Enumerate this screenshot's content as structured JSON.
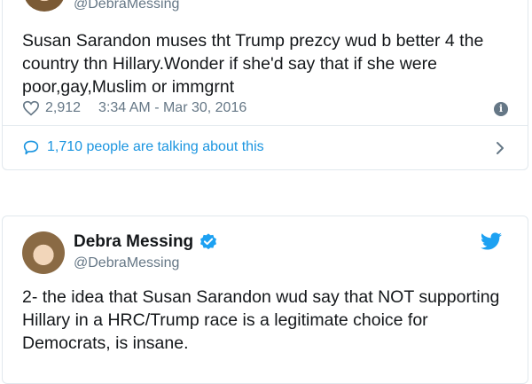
{
  "tweet1": {
    "handle": "@DebraMessing",
    "text": "Susan Sarandon muses tht Trump prezcy wud b better 4 the country thn Hillary.Wonder if she'd say that if she were poor,gay,Muslim or immgrnt",
    "likes": "2,912",
    "timestamp": "3:34 AM - Mar 30, 2016",
    "talking": "1,710 people are talking about this",
    "icons": {
      "like": "heart-icon",
      "info": "info-icon",
      "talk": "speech-bubble-icon",
      "chevron": "chevron-right-icon"
    }
  },
  "tweet2": {
    "name": "Debra Messing",
    "handle": "@DebraMessing",
    "text": "2- the idea that Susan Sarandon wud say that NOT supporting Hillary in a HRC/Trump race is a legitimate choice for Democrats, is insane.",
    "icons": {
      "verified": "verified-badge-icon",
      "twitter": "twitter-bird-icon"
    }
  },
  "colors": {
    "accent": "#1da1f2",
    "link": "#1b95e0",
    "muted": "#657786",
    "text": "#14171a",
    "border": "#e1e8ed"
  }
}
